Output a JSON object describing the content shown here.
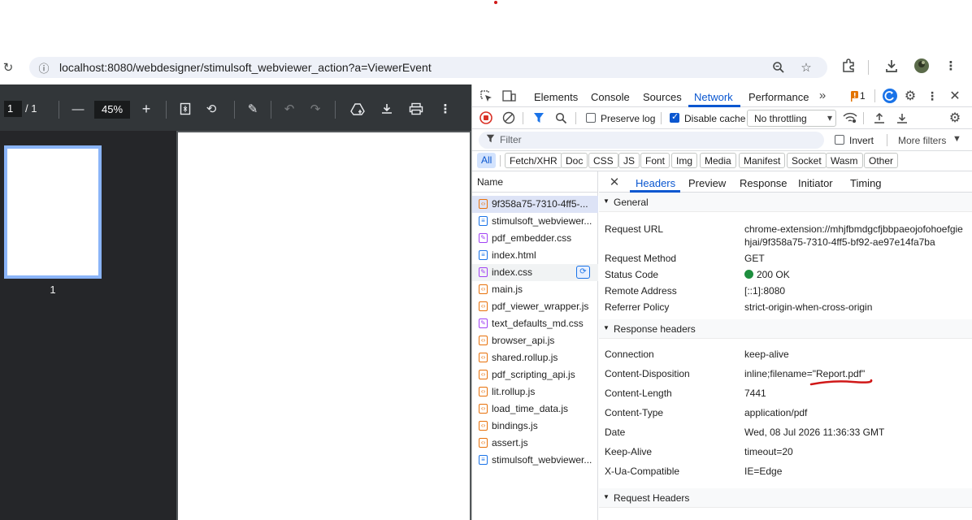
{
  "browser": {
    "url": "localhost:8080/webdesigner/stimulsoft_webviewer_action?a=ViewerEvent"
  },
  "pdf_viewer": {
    "current_page": "1",
    "page_total": "/ 1",
    "zoom": "45%",
    "thumbnail_label": "1"
  },
  "devtools": {
    "tabs": [
      "Elements",
      "Console",
      "Sources",
      "Network",
      "Performance"
    ],
    "active_tab": "Network",
    "issues_count": "1",
    "toolbar": {
      "preserve_log": "Preserve log",
      "disable_cache": "Disable cache",
      "throttling": "No throttling"
    },
    "filter": {
      "placeholder": "Filter",
      "invert": "Invert",
      "more_filters": "More filters"
    },
    "type_filters": [
      "All",
      "Fetch/XHR",
      "Doc",
      "CSS",
      "JS",
      "Font",
      "Img",
      "Media",
      "Manifest",
      "Socket",
      "Wasm",
      "Other"
    ],
    "name_header": "Name",
    "requests": [
      {
        "name": "9f358a75-7310-4ff5-...",
        "kind": "js"
      },
      {
        "name": "stimulsoft_webviewer...",
        "kind": "doc"
      },
      {
        "name": "pdf_embedder.css",
        "kind": "css"
      },
      {
        "name": "index.html",
        "kind": "doc"
      },
      {
        "name": "index.css",
        "kind": "css"
      },
      {
        "name": "main.js",
        "kind": "js"
      },
      {
        "name": "pdf_viewer_wrapper.js",
        "kind": "js"
      },
      {
        "name": "text_defaults_md.css",
        "kind": "css"
      },
      {
        "name": "browser_api.js",
        "kind": "js"
      },
      {
        "name": "shared.rollup.js",
        "kind": "js"
      },
      {
        "name": "pdf_scripting_api.js",
        "kind": "js"
      },
      {
        "name": "lit.rollup.js",
        "kind": "js"
      },
      {
        "name": "load_time_data.js",
        "kind": "js"
      },
      {
        "name": "bindings.js",
        "kind": "js"
      },
      {
        "name": "assert.js",
        "kind": "js"
      },
      {
        "name": "stimulsoft_webviewer...",
        "kind": "doc"
      }
    ],
    "detail_tabs": [
      "Headers",
      "Preview",
      "Response",
      "Initiator",
      "Timing"
    ],
    "general": {
      "title": "General",
      "request_url_label": "Request URL",
      "request_url_line1": "chrome-extension://mhjfbmdgcfjbbpaeojofohoefgie",
      "request_url_line2": "hjai/9f358a75-7310-4ff5-bf92-ae97e14fa7ba",
      "request_method_label": "Request Method",
      "request_method": "GET",
      "status_code_label": "Status Code",
      "status_code": "200 OK",
      "remote_address_label": "Remote Address",
      "remote_address": "[::1]:8080",
      "referrer_policy_label": "Referrer Policy",
      "referrer_policy": "strict-origin-when-cross-origin"
    },
    "response_headers": {
      "title": "Response headers",
      "items": [
        {
          "key": "Connection",
          "value": "keep-alive"
        },
        {
          "key": "Content-Disposition",
          "value": "inline;filename=\"Report.pdf\""
        },
        {
          "key": "Content-Length",
          "value": "7441"
        },
        {
          "key": "Content-Type",
          "value": "application/pdf"
        },
        {
          "key": "Date",
          "value": "Wed, 08 Jul 2026 11:36:33 GMT"
        },
        {
          "key": "Keep-Alive",
          "value": "timeout=20"
        },
        {
          "key": "X-Ua-Compatible",
          "value": "IE=Edge"
        }
      ]
    },
    "request_headers": {
      "title": "Request Headers"
    }
  },
  "colors": {
    "accent": "#0b57d0",
    "annotation_red": "#d01818",
    "status_green": "#1e8e3e"
  }
}
